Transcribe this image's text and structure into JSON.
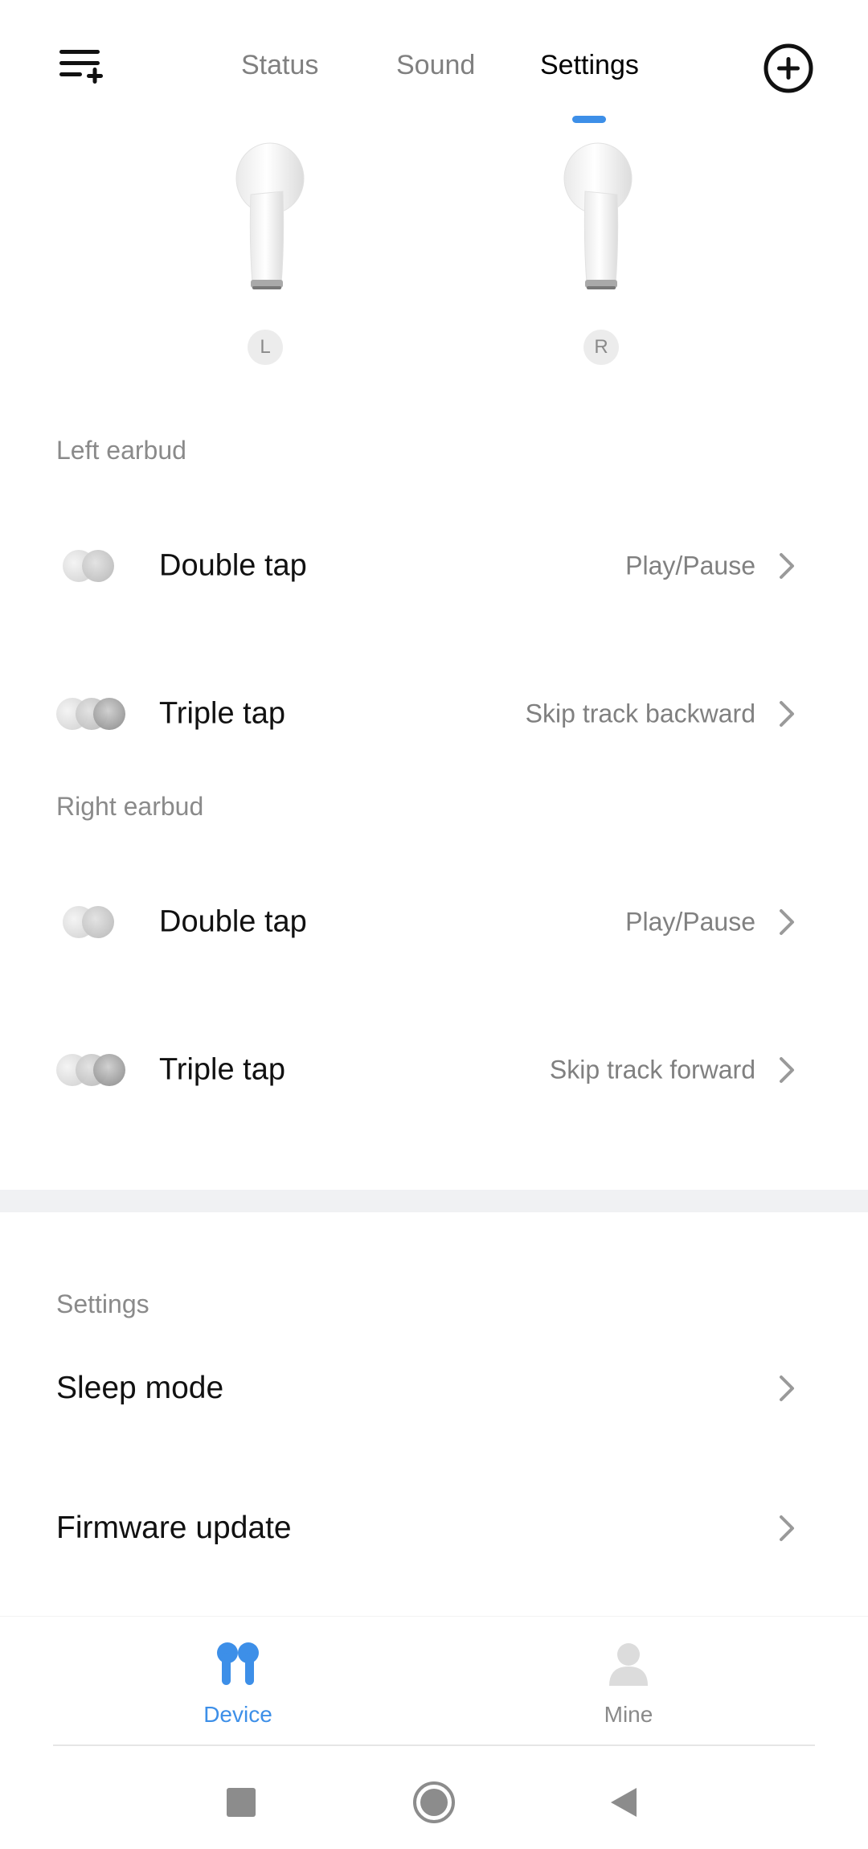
{
  "header": {
    "tabs": [
      {
        "label": "Status",
        "active": false
      },
      {
        "label": "Sound",
        "active": false
      },
      {
        "label": "Settings",
        "active": true
      }
    ],
    "menu_icon": "playlist-add-icon",
    "add_icon": "circle-plus-icon",
    "accent_color": "#3d8fe8"
  },
  "earbuds": {
    "left_badge": "L",
    "right_badge": "R"
  },
  "left_earbud": {
    "section_label": "Left earbud",
    "rows": [
      {
        "title": "Double tap",
        "value": "Play/Pause",
        "icon": "double-tap-icon"
      },
      {
        "title": "Triple tap",
        "value": "Skip track backward",
        "icon": "triple-tap-icon"
      }
    ]
  },
  "right_earbud": {
    "section_label": "Right earbud",
    "rows": [
      {
        "title": "Double tap",
        "value": "Play/Pause",
        "icon": "double-tap-icon"
      },
      {
        "title": "Triple tap",
        "value": "Skip track forward",
        "icon": "triple-tap-icon"
      }
    ]
  },
  "settings": {
    "section_label": "Settings",
    "items": [
      {
        "title": "Sleep mode"
      },
      {
        "title": "Firmware update"
      }
    ]
  },
  "bottom_nav": {
    "items": [
      {
        "label": "Device",
        "icon": "earbuds-icon",
        "active": true
      },
      {
        "label": "Mine",
        "icon": "person-icon",
        "active": false
      }
    ]
  },
  "system_nav": {
    "icons": [
      "recents-square-icon",
      "home-circle-icon",
      "back-triangle-icon"
    ]
  }
}
